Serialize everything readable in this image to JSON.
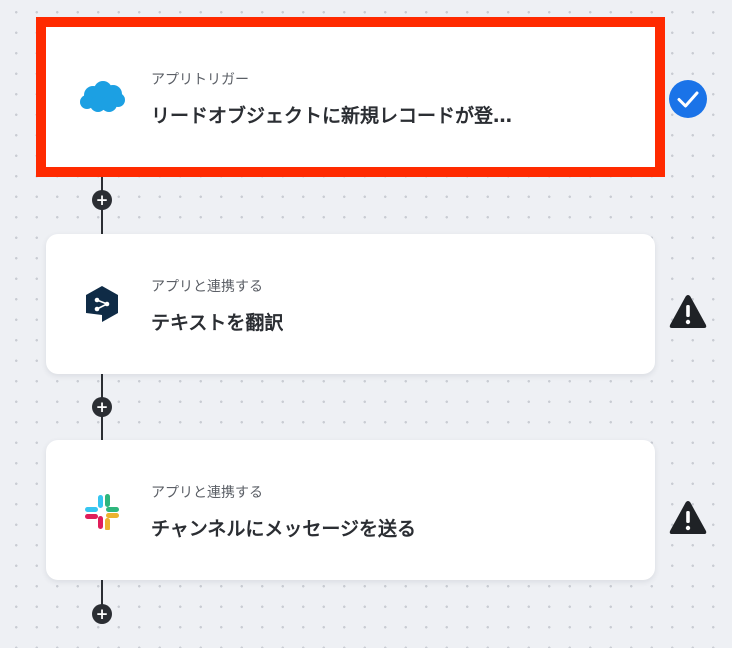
{
  "steps": [
    {
      "subtitle": "アプリトリガー",
      "title": "リードオブジェクトに新規レコードが登…",
      "app_icon": "salesforce-cloud-icon",
      "status": "check-circle-icon"
    },
    {
      "subtitle": "アプリと連携する",
      "title": "テキストを翻訳",
      "app_icon": "deepl-icon",
      "status": "warning-triangle-icon"
    },
    {
      "subtitle": "アプリと連携する",
      "title": "チャンネルにメッセージを送る",
      "app_icon": "slack-icon",
      "status": "warning-triangle-icon"
    }
  ],
  "add_step": {
    "label": "+"
  },
  "colors": {
    "selected_outline": "#ff2a00",
    "check_blue": "#1a73e8",
    "dark": "#2b2e33",
    "salesforce": "#1ca0e3",
    "deepl": "#0f2b46"
  }
}
